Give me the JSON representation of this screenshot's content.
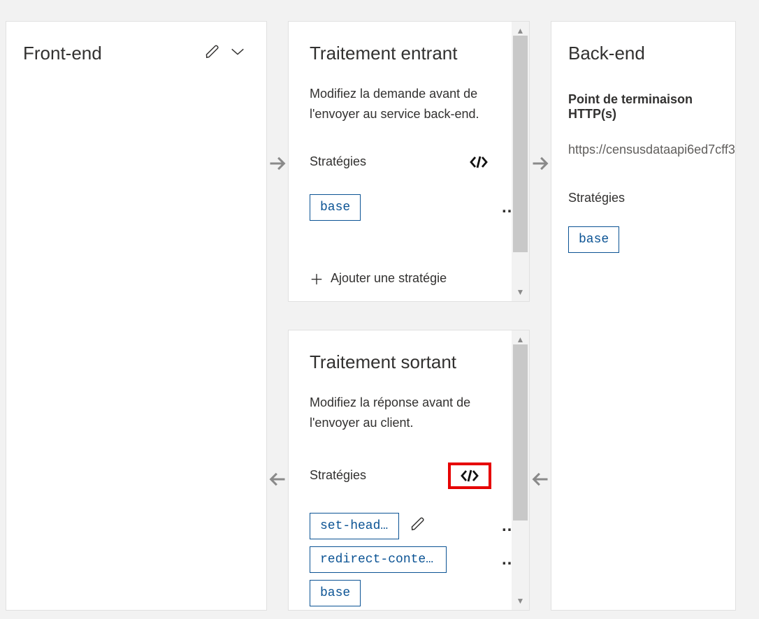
{
  "frontend": {
    "title": "Front-end"
  },
  "inbound": {
    "title": "Traitement entrant",
    "desc": "Modifiez la demande avant de l'envoyer au service back-end.",
    "strategies_label": "Stratégies",
    "chips": [
      "base"
    ],
    "add_label": "Ajouter une stratégie"
  },
  "outbound": {
    "title": "Traitement sortant",
    "desc": "Modifiez la réponse avant de l'envoyer au client.",
    "strategies_label": "Stratégies",
    "chips": [
      "set-head…",
      "redirect-conte…",
      "base"
    ]
  },
  "backend": {
    "title": "Back-end",
    "sub": "Point de terminaison HTTP(s)",
    "url": "https://censusdataapi6ed7cff3",
    "strategies_label": "Stratégies",
    "chips": [
      "base"
    ]
  }
}
